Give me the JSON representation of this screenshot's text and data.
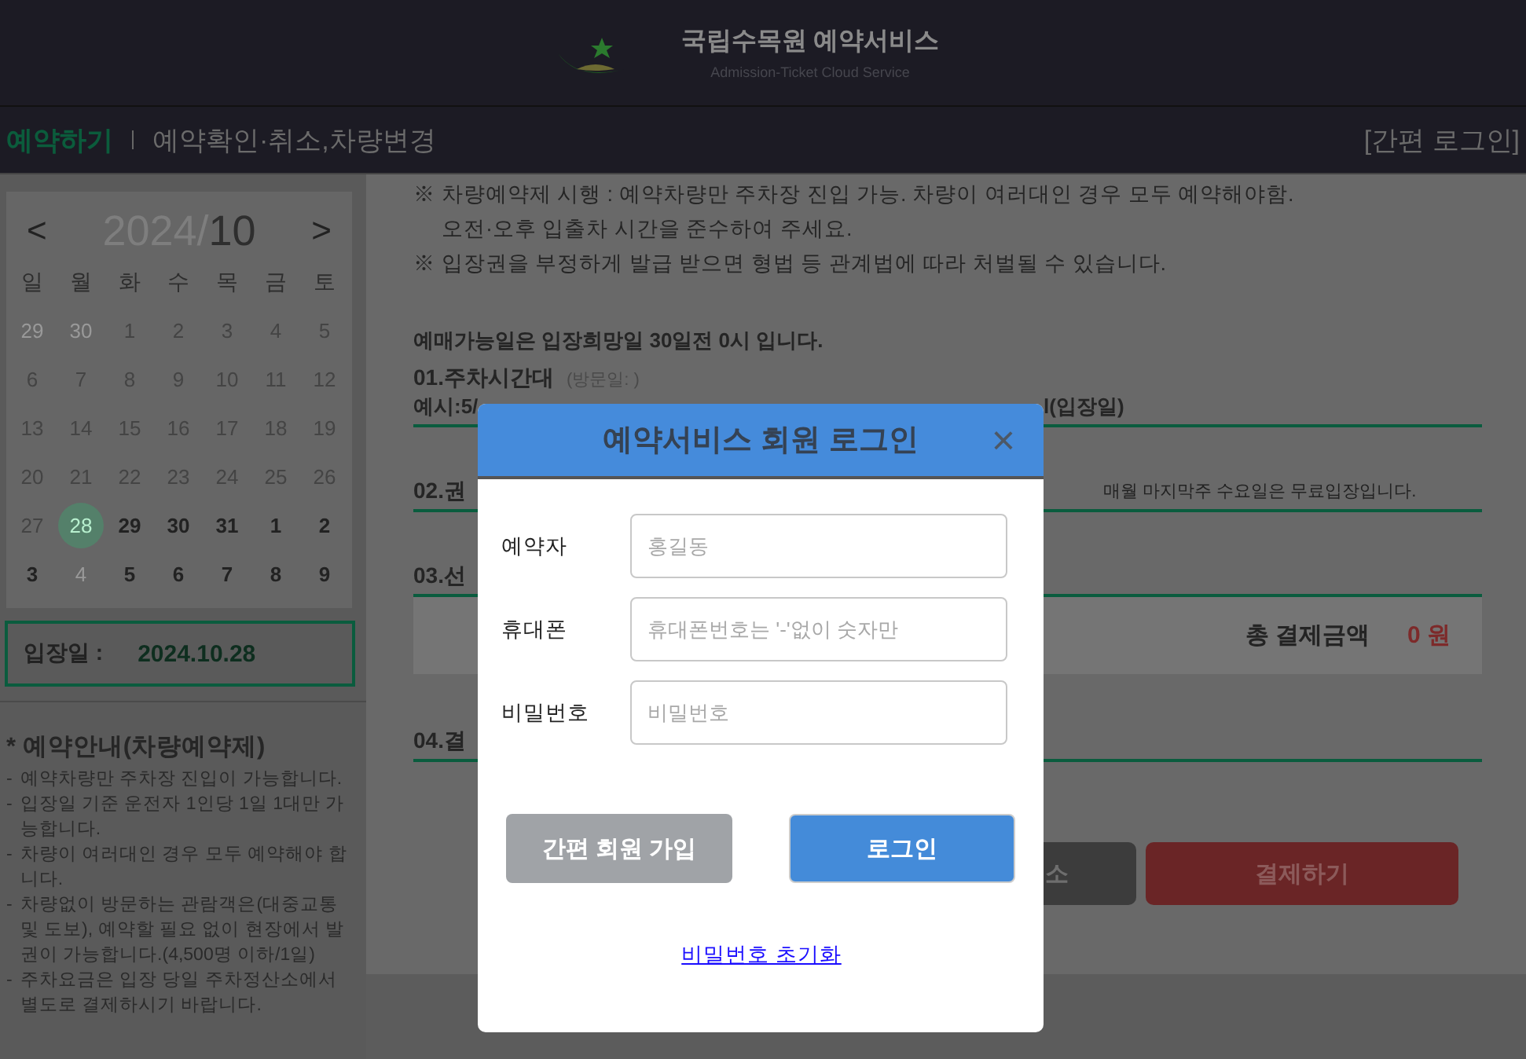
{
  "header": {
    "title": "국립수목원 예약서비스",
    "subtitle": "Admission-Ticket Cloud Service"
  },
  "nav": {
    "items": [
      {
        "label": "예약하기",
        "selected": true
      },
      {
        "label": "예약확인·취소,차량변경",
        "selected": false
      }
    ],
    "login": "[간편 로그인]"
  },
  "calendar": {
    "prev": "<",
    "next": ">",
    "year": "2024/",
    "month": "10",
    "weekdays": [
      "일",
      "월",
      "화",
      "수",
      "목",
      "금",
      "토"
    ],
    "days": [
      {
        "label": "29",
        "disabled": true,
        "bookable": false,
        "selected": false
      },
      {
        "label": "30",
        "disabled": true,
        "bookable": false,
        "selected": false
      },
      {
        "label": "1",
        "disabled": false,
        "bookable": false,
        "selected": false
      },
      {
        "label": "2",
        "disabled": false,
        "bookable": false,
        "selected": false
      },
      {
        "label": "3",
        "disabled": false,
        "bookable": false,
        "selected": false
      },
      {
        "label": "4",
        "disabled": false,
        "bookable": false,
        "selected": false
      },
      {
        "label": "5",
        "disabled": false,
        "bookable": false,
        "selected": false
      },
      {
        "label": "6",
        "disabled": false,
        "bookable": false,
        "selected": false
      },
      {
        "label": "7",
        "disabled": false,
        "bookable": false,
        "selected": false
      },
      {
        "label": "8",
        "disabled": false,
        "bookable": false,
        "selected": false
      },
      {
        "label": "9",
        "disabled": false,
        "bookable": false,
        "selected": false
      },
      {
        "label": "10",
        "disabled": false,
        "bookable": false,
        "selected": false
      },
      {
        "label": "11",
        "disabled": false,
        "bookable": false,
        "selected": false
      },
      {
        "label": "12",
        "disabled": false,
        "bookable": false,
        "selected": false
      },
      {
        "label": "13",
        "disabled": false,
        "bookable": false,
        "selected": false
      },
      {
        "label": "14",
        "disabled": false,
        "bookable": false,
        "selected": false
      },
      {
        "label": "15",
        "disabled": false,
        "bookable": false,
        "selected": false
      },
      {
        "label": "16",
        "disabled": false,
        "bookable": false,
        "selected": false
      },
      {
        "label": "17",
        "disabled": false,
        "bookable": false,
        "selected": false
      },
      {
        "label": "18",
        "disabled": false,
        "bookable": false,
        "selected": false
      },
      {
        "label": "19",
        "disabled": false,
        "bookable": false,
        "selected": false
      },
      {
        "label": "20",
        "disabled": false,
        "bookable": false,
        "selected": false
      },
      {
        "label": "21",
        "disabled": false,
        "bookable": false,
        "selected": false
      },
      {
        "label": "22",
        "disabled": false,
        "bookable": false,
        "selected": false
      },
      {
        "label": "23",
        "disabled": false,
        "bookable": false,
        "selected": false
      },
      {
        "label": "24",
        "disabled": false,
        "bookable": false,
        "selected": false
      },
      {
        "label": "25",
        "disabled": false,
        "bookable": false,
        "selected": false
      },
      {
        "label": "26",
        "disabled": false,
        "bookable": false,
        "selected": false
      },
      {
        "label": "27",
        "disabled": false,
        "bookable": false,
        "selected": false
      },
      {
        "label": "28",
        "disabled": false,
        "bookable": true,
        "selected": true
      },
      {
        "label": "29",
        "disabled": false,
        "bookable": true,
        "selected": false
      },
      {
        "label": "30",
        "disabled": false,
        "bookable": true,
        "selected": false
      },
      {
        "label": "31",
        "disabled": false,
        "bookable": true,
        "selected": false
      },
      {
        "label": "1",
        "disabled": false,
        "bookable": true,
        "selected": false
      },
      {
        "label": "2",
        "disabled": false,
        "bookable": true,
        "selected": false
      },
      {
        "label": "3",
        "disabled": false,
        "bookable": true,
        "selected": false
      },
      {
        "label": "4",
        "disabled": true,
        "bookable": false,
        "selected": false
      },
      {
        "label": "5",
        "disabled": false,
        "bookable": true,
        "selected": false
      },
      {
        "label": "6",
        "disabled": false,
        "bookable": true,
        "selected": false
      },
      {
        "label": "7",
        "disabled": false,
        "bookable": true,
        "selected": false
      },
      {
        "label": "8",
        "disabled": false,
        "bookable": true,
        "selected": false
      },
      {
        "label": "9",
        "disabled": false,
        "bookable": true,
        "selected": false
      }
    ]
  },
  "entry_date": {
    "label": "입장일 :",
    "value": "2024.10.28"
  },
  "guide": {
    "title": "* 예약안내(차량예약제)",
    "items": [
      {
        "marker": "-",
        "text": "예약차량만 주차장 진입이 가능합니다."
      },
      {
        "marker": "-",
        "text": "입장일 기준 운전자 1인당 1일 1대만 가능합니다."
      },
      {
        "marker": "-",
        "text": "차량이 여러대인 경우 모두 예약해야 합니다."
      },
      {
        "marker": "-",
        "text": "차량없이 방문하는 관람객은(대중교통 및 도보), 예약할 필요 없이 현장에서 발권이 가능합니다.(4,500명 이하/1일)"
      },
      {
        "marker": "-",
        "text": "주차요금은 입장 당일 주차정산소에서 별도로 결제하시기 바랍니다."
      }
    ]
  },
  "notices": [
    "※ 차량예약제 시행 : 예약차량만 주차장 진입 가능. 차량이 여러대인 경우 모두 예약해야함.",
    "오전·오후 입출차 시간을 준수하여 주세요.",
    "※ 입장권을 부정하게 발급 받으면 형법 등 관계법에 따라 처벌될 수 있습니다."
  ],
  "sale_note": "예매가능일은 입장희망일 30일전 0시 입니다.",
  "sections": {
    "parking": {
      "title": "01.주차시간대",
      "visit": "(방문일: )",
      "example_left": "예시:5/",
      "example_right": "l(입장일)"
    },
    "ticket": {
      "title": "02.권",
      "note": "매월 마지막주 수요일은 무료입장입니다."
    },
    "select": {
      "title": "03.선"
    },
    "total": {
      "label": "총 결제금액",
      "amount": "0 원"
    },
    "payment": {
      "title": "04.결"
    }
  },
  "actions": {
    "cancel": "소",
    "pay": "결제하기"
  },
  "modal": {
    "title": "예약서비스 회원 로그인",
    "close": "×",
    "fields": [
      {
        "label": "예약자",
        "placeholder": "홍길동"
      },
      {
        "label": "휴대폰",
        "placeholder": "휴대폰번호는 '-'없이 숫자만"
      },
      {
        "label": "비밀번호",
        "placeholder": "비밀번호"
      }
    ],
    "signup": "간편 회원 가입",
    "login": "로그인",
    "reset": "비밀번호 초기화"
  }
}
